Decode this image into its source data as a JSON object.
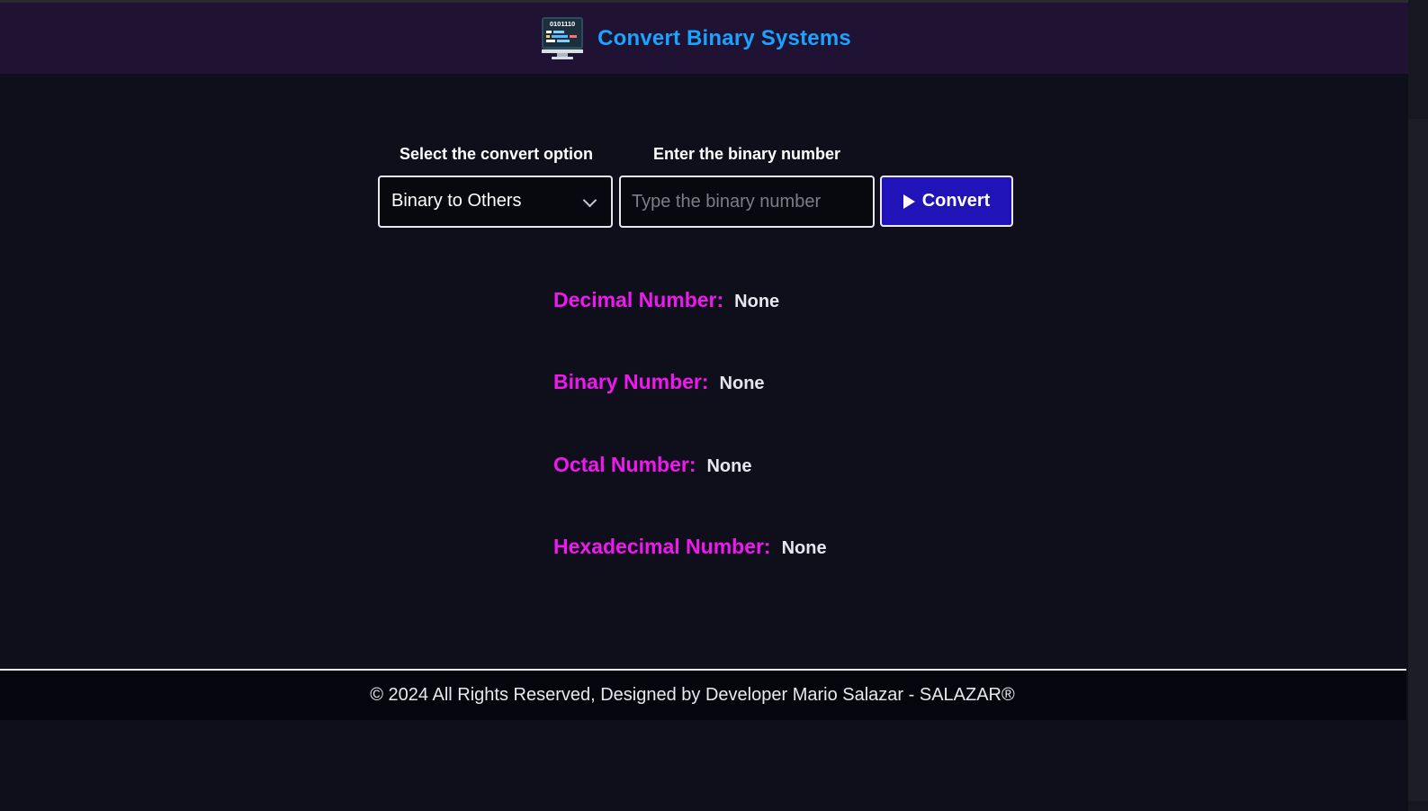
{
  "header": {
    "title": "Convert Binary Systems",
    "logo_icon": "computer-monitor-binary-icon",
    "logo_text": "0101110",
    "title_color": "#1aa3ff",
    "background": "#201232"
  },
  "form": {
    "select_label": "Select the convert option",
    "select_value": "Binary to Others",
    "input_label": "Enter the binary number",
    "input_placeholder": "Type the binary number",
    "input_value": "",
    "button_label": "Convert",
    "button_icon": "play-icon",
    "button_color": "#2013b8"
  },
  "results": [
    {
      "label": "Decimal Number:",
      "value": "None"
    },
    {
      "label": "Binary Number:",
      "value": "None"
    },
    {
      "label": "Octal Number:",
      "value": "None"
    },
    {
      "label": "Hexadecimal Number:",
      "value": "None"
    }
  ],
  "result_label_color": "#ef18ef",
  "footer": {
    "text": "© 2024 All Rights Reserved, Designed by Developer Mario Salazar - SALAZAR®"
  }
}
